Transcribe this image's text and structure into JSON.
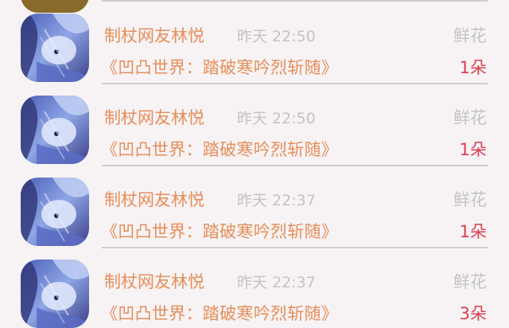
{
  "feed": {
    "items": [
      {
        "user": "制杖网友林悦",
        "time": "昨天 22:50",
        "gift": "鲜花",
        "book": "《凹凸世界：踏破寒吟烈斩随》",
        "count": "1朵"
      },
      {
        "user": "制杖网友林悦",
        "time": "昨天 22:50",
        "gift": "鲜花",
        "book": "《凹凸世界：踏破寒吟烈斩随》",
        "count": "1朵"
      },
      {
        "user": "制杖网友林悦",
        "time": "昨天 22:37",
        "gift": "鲜花",
        "book": "《凹凸世界：踏破寒吟烈斩随》",
        "count": "1朵"
      },
      {
        "user": "制杖网友林悦",
        "time": "昨天 22:37",
        "gift": "鲜花",
        "book": "《凹凸世界：踏破寒吟烈斩随》",
        "count": "3朵"
      }
    ]
  },
  "colors": {
    "background": "#f7f3f4",
    "accent_orange": "#e58e5a",
    "count_red": "#d84150",
    "muted_gray": "#c3c3c3",
    "divider": "#cfcbcc"
  },
  "icons": {
    "avatar": "user-avatar-anime-portrait"
  }
}
